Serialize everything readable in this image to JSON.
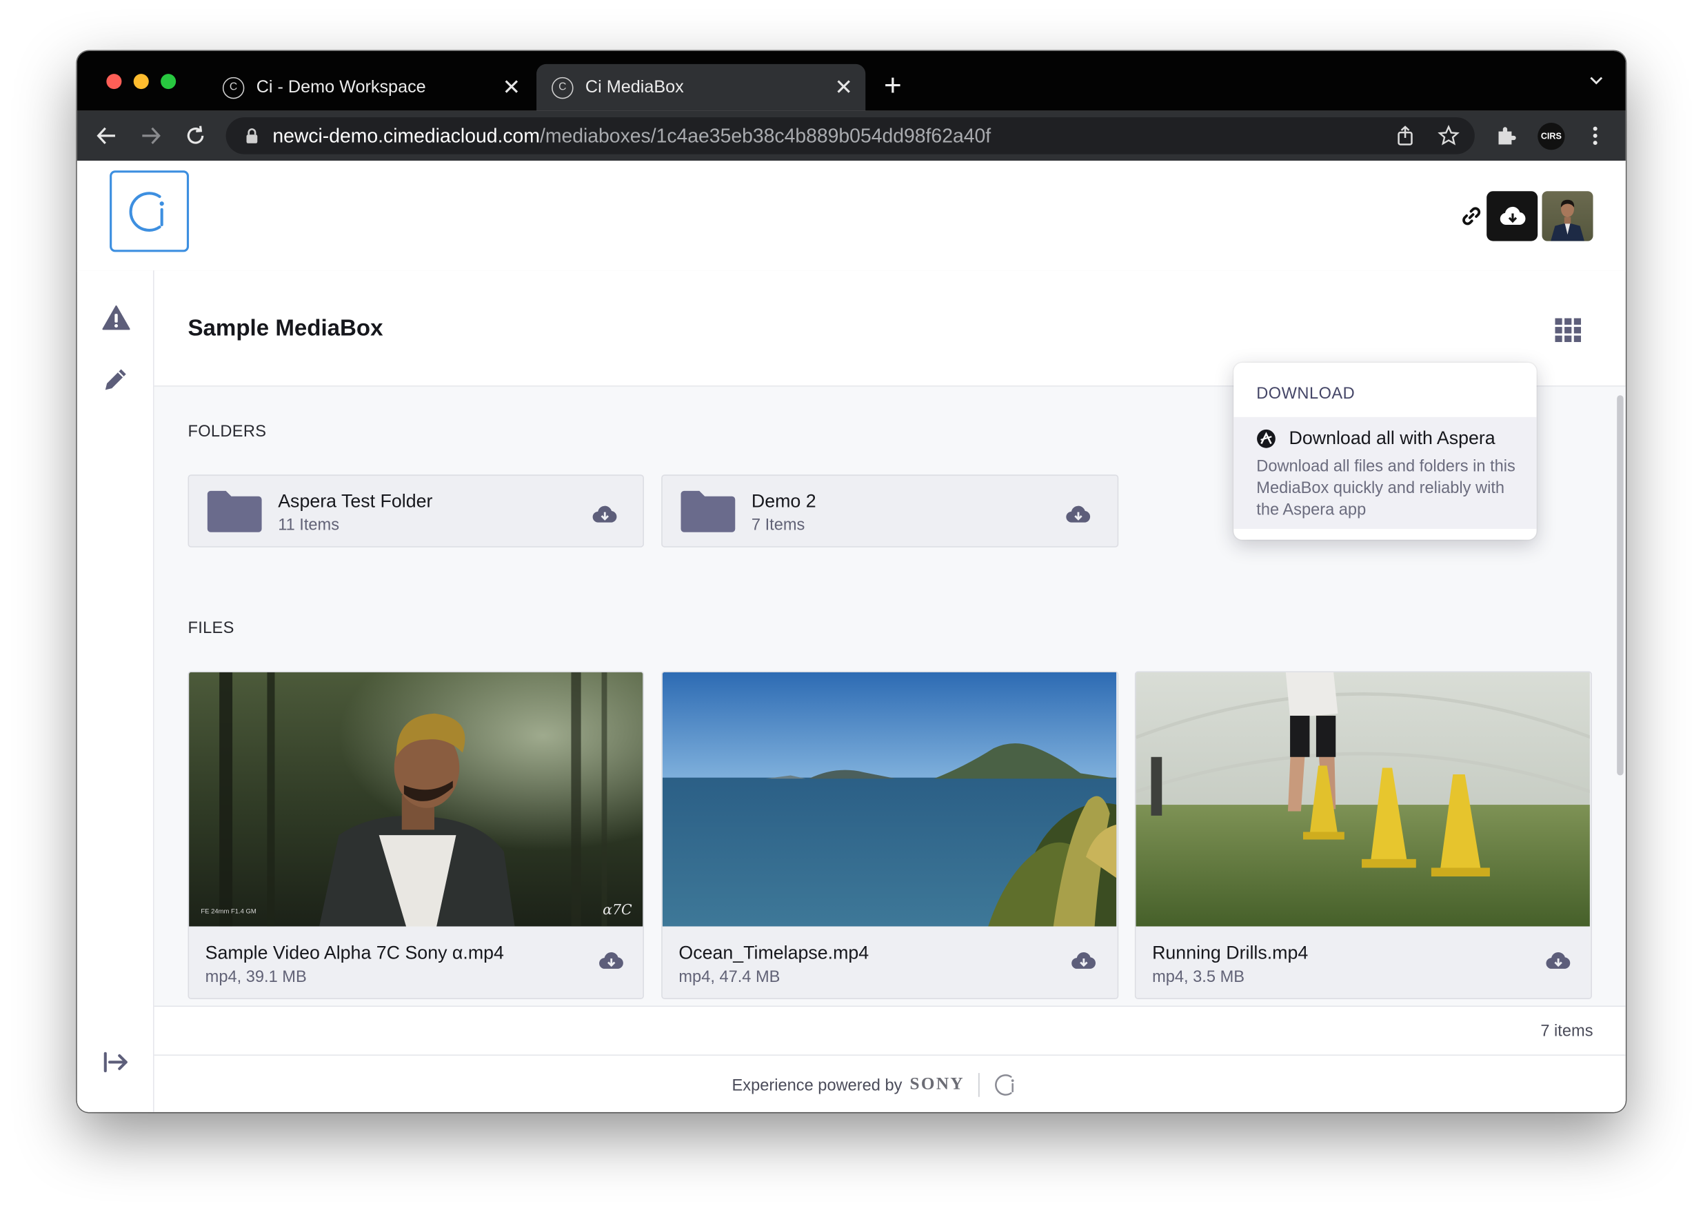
{
  "browser": {
    "tabs": [
      {
        "title": "Ci - Demo Workspace",
        "active": false
      },
      {
        "title": "Ci MediaBox",
        "active": true
      }
    ],
    "new_tab_label": "+",
    "close_glyph": "✕",
    "url_host": "newci-demo.cimediacloud.com",
    "url_path": "/mediaboxes/1c4ae35eb38c4b889b054dd98f62a40f",
    "profile_label": "CIRS",
    "traffic_lights": [
      "#fe5f57",
      "#febc2e",
      "#28c840"
    ]
  },
  "header": {
    "logo_text": "Ci",
    "icons": [
      "link-icon",
      "cloud-download-icon",
      "user-avatar"
    ]
  },
  "sidenav": {
    "icons": [
      "warning-icon",
      "pencil-icon",
      "exit-icon"
    ]
  },
  "mediabox": {
    "title": "Sample MediaBox",
    "folders_label": "FOLDERS",
    "files_label": "FILES",
    "folders": [
      {
        "name": "Aspera Test Folder",
        "count": "11 Items"
      },
      {
        "name": "Demo 2",
        "count": "7 Items"
      }
    ],
    "files": [
      {
        "name": "Sample Video Alpha 7C Sony α.mp4",
        "meta": "mp4, 39.1 MB",
        "overlay_left": "FE 24mm F1.4 GM",
        "overlay_right": "α7C"
      },
      {
        "name": "Ocean_Timelapse.mp4",
        "meta": "mp4, 47.4 MB"
      },
      {
        "name": "Running Drills.mp4",
        "meta": "mp4, 3.5 MB"
      }
    ],
    "item_count": "7 items"
  },
  "footer": {
    "powered_by": "Experience powered by",
    "brand": "SONY"
  },
  "download_menu": {
    "heading": "DOWNLOAD",
    "item_title": "Download all with Aspera",
    "item_desc": "Download all files and folders in this MediaBox quickly and reliably with the Aspera app"
  },
  "colors": {
    "accent": "#3d8fe0",
    "icon": "#5d5e7a",
    "folder": "#6a6b8c"
  }
}
